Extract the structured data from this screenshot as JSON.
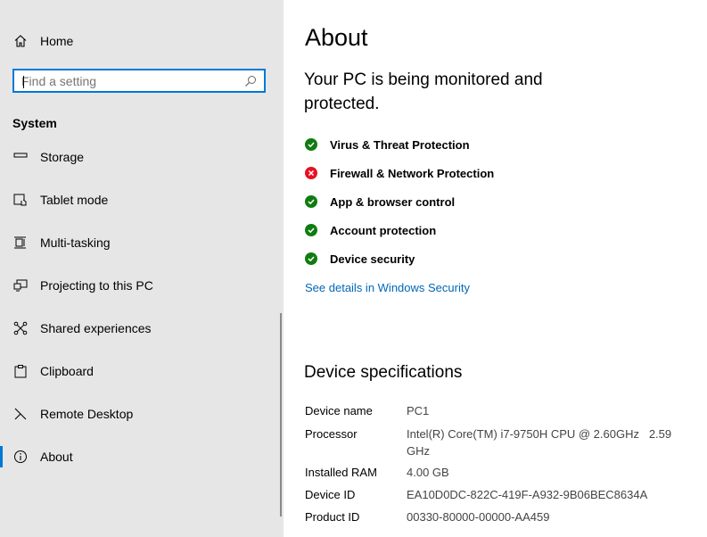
{
  "sidebar": {
    "home_label": "Home",
    "search_placeholder": "Find a setting",
    "section_label": "System",
    "items": [
      {
        "label": "Storage",
        "icon": "storage-icon"
      },
      {
        "label": "Tablet mode",
        "icon": "tablet-mode-icon"
      },
      {
        "label": "Multi-tasking",
        "icon": "multitasking-icon"
      },
      {
        "label": "Projecting to this PC",
        "icon": "projecting-icon"
      },
      {
        "label": "Shared experiences",
        "icon": "shared-experiences-icon"
      },
      {
        "label": "Clipboard",
        "icon": "clipboard-icon"
      },
      {
        "label": "Remote Desktop",
        "icon": "remote-desktop-icon"
      },
      {
        "label": "About",
        "icon": "info-icon",
        "selected": true
      }
    ]
  },
  "main": {
    "title": "About",
    "protection_status": "Your PC is being monitored and protected.",
    "protections": [
      {
        "label": "Virus & Threat Protection",
        "status": "ok"
      },
      {
        "label": "Firewall & Network Protection",
        "status": "error"
      },
      {
        "label": "App & browser control",
        "status": "ok"
      },
      {
        "label": "Account protection",
        "status": "ok"
      },
      {
        "label": "Device security",
        "status": "ok"
      }
    ],
    "security_link": "See details in Windows Security",
    "specs_title": "Device specifications",
    "specs": [
      {
        "key": "Device name",
        "value": "PC1"
      },
      {
        "key": "Processor",
        "value": "Intel(R) Core(TM) i7-9750H CPU @ 2.60GHz   2.59 GHz"
      },
      {
        "key": "Installed RAM",
        "value": "4.00 GB"
      },
      {
        "key": "Device ID",
        "value": "EA10D0DC-822C-419F-A932-9B06BEC8634A"
      },
      {
        "key": "Product ID",
        "value": "00330-80000-00000-AA459"
      }
    ]
  },
  "colors": {
    "accent": "#0078d7",
    "link": "#0067b8",
    "ok": "#107c10",
    "error": "#e81123",
    "sidebar_bg": "#e6e6e6"
  }
}
